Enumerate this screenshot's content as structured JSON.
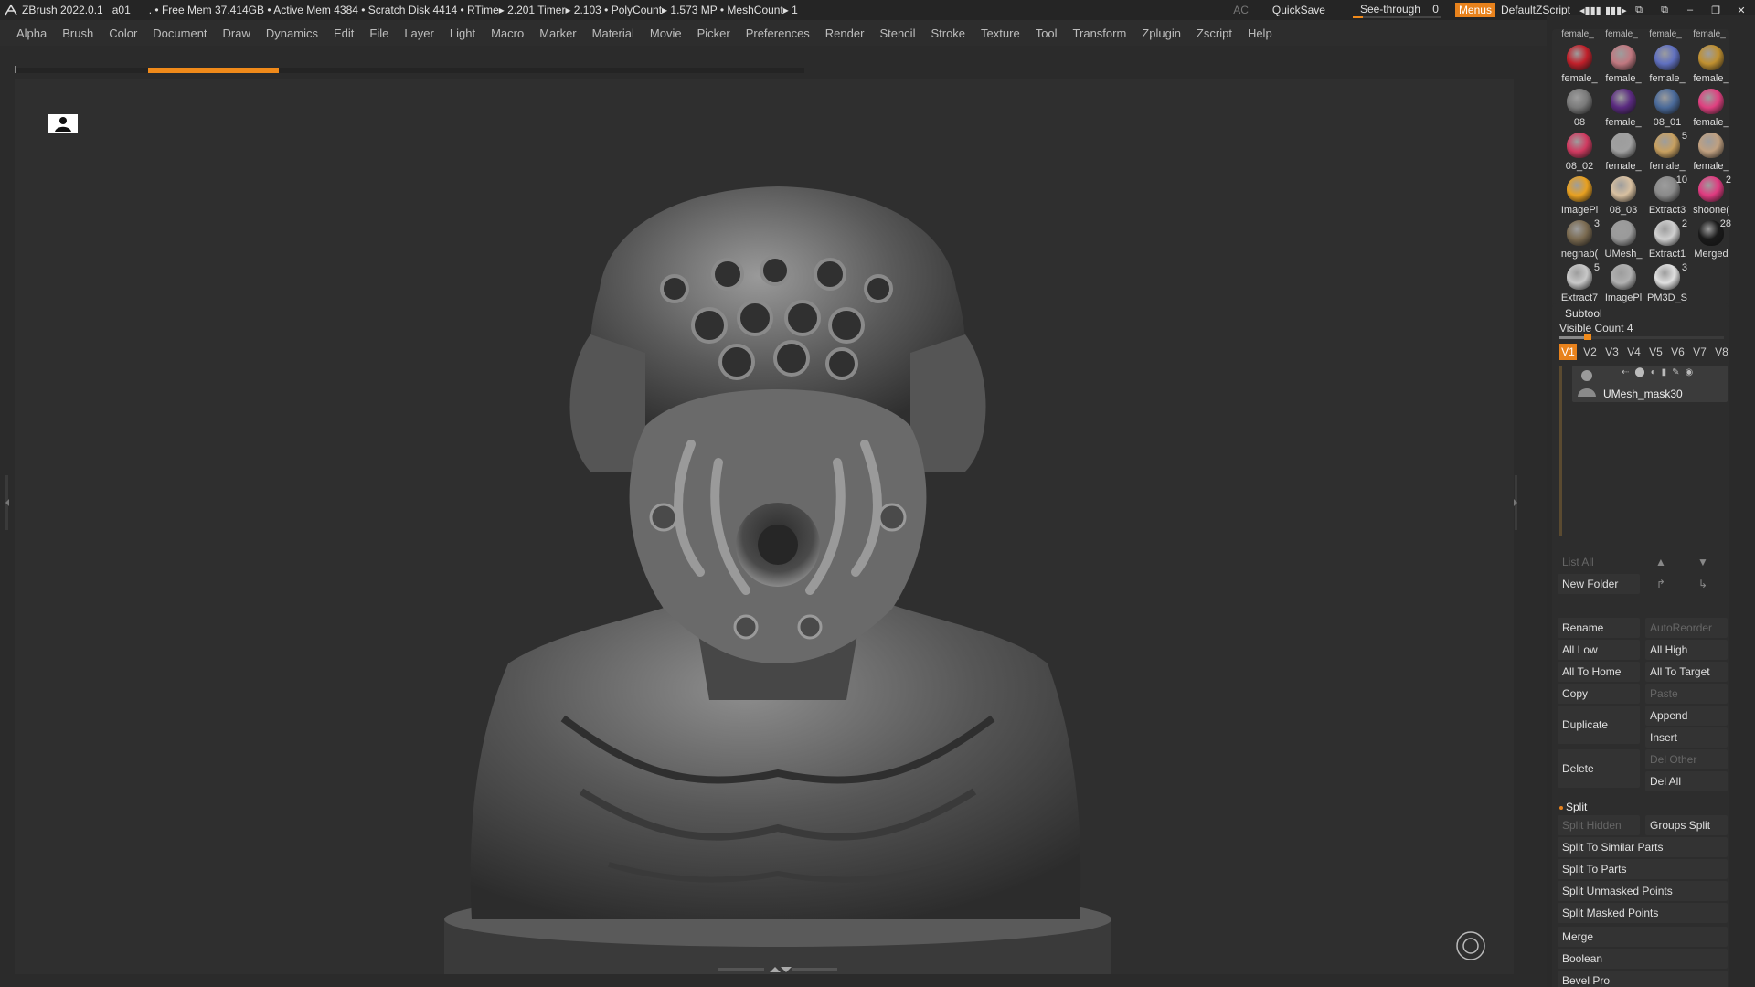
{
  "titlebar": {
    "app": "ZBrush 2022.0.1",
    "doc": "a01",
    "stats": ". • Free Mem 37.414GB • Active Mem 4384 • Scratch Disk 4414 •  RTime▸ 2.201 Timer▸ 2.103 • PolyCount▸ 1.573 MP  • MeshCount▸ 1",
    "ac": "AC",
    "quicksave": "QuickSave",
    "see_through_label": "See-through",
    "see_through_value": "0",
    "see_through_fraction": 0.12,
    "menus": "Menus",
    "script": "DefaultZScript"
  },
  "menubar": [
    "Alpha",
    "Brush",
    "Color",
    "Document",
    "Draw",
    "Dynamics",
    "Edit",
    "File",
    "Layer",
    "Light",
    "Macro",
    "Marker",
    "Material",
    "Movie",
    "Picker",
    "Preferences",
    "Render",
    "Stencil",
    "Stroke",
    "Texture",
    "Tool",
    "Transform",
    "Zplugin",
    "Zscript",
    "Help"
  ],
  "colors": {
    "accent": "#e8821c",
    "background": "#2b2b2b"
  },
  "toolthumbs": {
    "top_row": [
      "female_",
      "female_",
      "female_",
      "female_"
    ],
    "items": [
      {
        "name": "female_",
        "count": "",
        "color": "#c0202a"
      },
      {
        "name": "female_",
        "count": "",
        "color": "#c07880"
      },
      {
        "name": "female_",
        "count": "",
        "color": "#6070c0"
      },
      {
        "name": "female_",
        "count": "",
        "color": "#c09030"
      },
      {
        "name": "08",
        "count": "",
        "color": "#7a7a7a"
      },
      {
        "name": "female_",
        "count": "",
        "color": "#5a2a80"
      },
      {
        "name": "08_01",
        "count": "",
        "color": "#4a6a9a"
      },
      {
        "name": "female_",
        "count": "",
        "color": "#e04080"
      },
      {
        "name": "08_02",
        "count": "",
        "color": "#d03a60"
      },
      {
        "name": "female_",
        "count": "",
        "color": "#a0a0a0"
      },
      {
        "name": "female_",
        "count": "5",
        "color": "#c8a060"
      },
      {
        "name": "female_",
        "count": "",
        "color": "#c0a080"
      },
      {
        "name": "ImagePl",
        "count": "",
        "color": "#e8a020"
      },
      {
        "name": "08_03",
        "count": "",
        "color": "#d8c0a0"
      },
      {
        "name": "Extract3",
        "count": "10",
        "color": "#8a8a8a"
      },
      {
        "name": "shoone(",
        "count": "2",
        "color": "#e03a80"
      },
      {
        "name": "negnab(",
        "count": "3",
        "color": "#7a6a50"
      },
      {
        "name": "UMesh_",
        "count": "",
        "color": "#9a9a9a"
      },
      {
        "name": "Extract1",
        "count": "2",
        "color": "#d0d0d0"
      },
      {
        "name": "Merged",
        "count": "28",
        "color": "#1a1a1a"
      },
      {
        "name": "Extract7",
        "count": "5",
        "color": "#c8c8c8"
      },
      {
        "name": "ImagePl",
        "count": "",
        "color": "#b0b0b0"
      },
      {
        "name": "PM3D_S",
        "count": "3",
        "color": "#e0e0e0"
      }
    ]
  },
  "subtool": {
    "title": "Subtool",
    "visible_count": "Visible Count 4",
    "visible_fraction": 0.15,
    "tabs": [
      "V1",
      "V2",
      "V3",
      "V4",
      "V5",
      "V6",
      "V7",
      "V8"
    ],
    "active_tab": "V1",
    "item_name": "UMesh_mask30",
    "list_all": "List All",
    "new_folder": "New Folder",
    "rename": "Rename",
    "auto_reorder": "AutoReorder",
    "all_low": "All Low",
    "all_high": "All High",
    "all_to_home": "All To Home",
    "all_to_target": "All To Target",
    "copy": "Copy",
    "paste": "Paste",
    "duplicate": "Duplicate",
    "append": "Append",
    "insert": "Insert",
    "delete": "Delete",
    "del_other": "Del Other",
    "del_all": "Del All",
    "split": "Split",
    "split_hidden": "Split Hidden",
    "groups_split": "Groups Split",
    "split_to_similar": "Split To Similar Parts",
    "split_to_parts": "Split To Parts",
    "split_unmasked": "Split Unmasked Points",
    "split_masked": "Split Masked Points",
    "merge": "Merge",
    "boolean": "Boolean",
    "bevel_pro": "Bevel Pro"
  }
}
